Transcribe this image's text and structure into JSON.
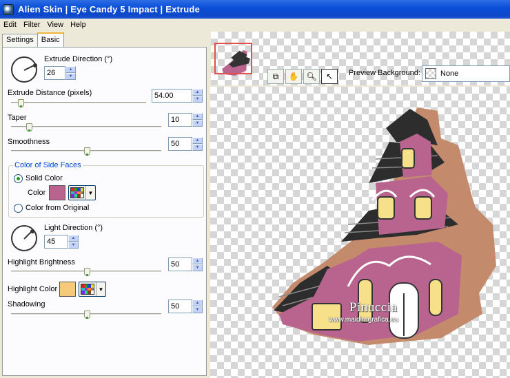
{
  "window": {
    "title": "Alien Skin | Eye Candy 5 Impact | Extrude"
  },
  "menu": [
    "Edit",
    "Filter",
    "View",
    "Help"
  ],
  "tabs": [
    {
      "label": "Settings"
    },
    {
      "label": "Basic",
      "active": true
    }
  ],
  "basic": {
    "extrude_direction": {
      "label": "Extrude Direction (°)",
      "value": "26"
    },
    "extrude_distance": {
      "label": "Extrude Distance (pixels)",
      "value": "54.00",
      "slider_fraction": 0.1
    },
    "taper": {
      "label": "Taper",
      "value": "10",
      "slider_fraction": 0.1
    },
    "smoothness": {
      "label": "Smoothness",
      "value": "50",
      "slider_fraction": 0.5
    },
    "side_faces": {
      "legend": "Color of Side Faces",
      "solid_color": "Solid Color",
      "color_label": "Color",
      "color_from_original": "Color from Original",
      "selected": "solid",
      "color": "#b9648f"
    },
    "light_direction": {
      "label": "Light Direction (°)",
      "value": "45"
    },
    "highlight_brightness": {
      "label": "Highlight Brightness",
      "value": "50",
      "slider_fraction": 0.5
    },
    "highlight_color": {
      "label": "Highlight Color",
      "color": "#f7c97a"
    },
    "shadowing": {
      "label": "Shadowing",
      "value": "50",
      "slider_fraction": 0.5
    }
  },
  "preview": {
    "background_label": "Preview Background:",
    "background_value": "None",
    "tools": [
      "zoom-fit-icon",
      "hand-icon",
      "magnifier-icon",
      "arrow-icon"
    ],
    "watermark_name": "Pinuccia",
    "watermark_url": "www.maidiregrafica.eu"
  }
}
